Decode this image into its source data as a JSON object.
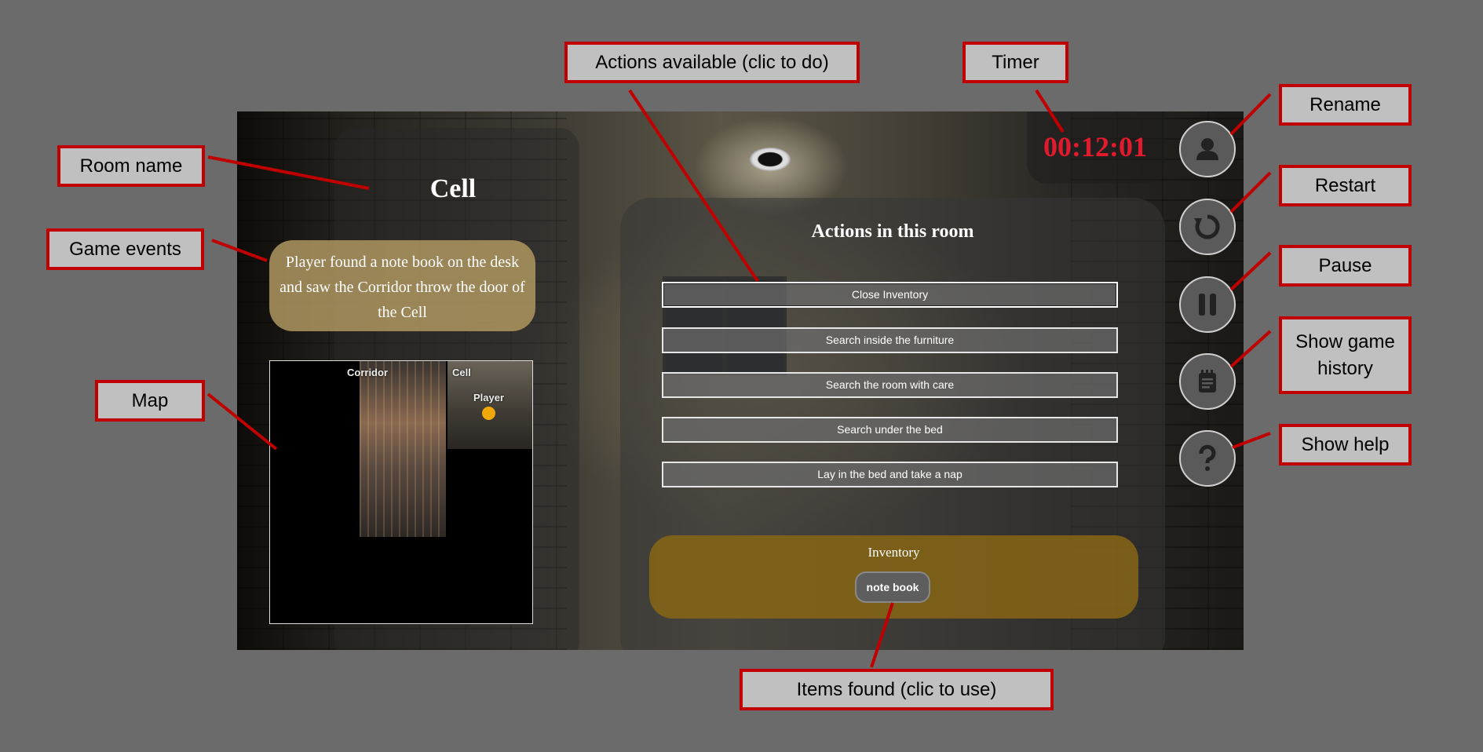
{
  "game": {
    "room_name": "Cell",
    "event_text": "Player found a note book on the desk and saw the Corridor throw the door of the Cell",
    "map": {
      "corridor_label": "Corridor",
      "cell_label": "Cell",
      "player_label": "Player"
    },
    "timer": "00:12:01",
    "actions_title": "Actions in this room",
    "actions": [
      "Close Inventory",
      "Search inside the furniture",
      "Search the room with care",
      "Search under the bed",
      "Lay in the bed and take a nap"
    ],
    "inventory_title": "Inventory",
    "inventory_items": [
      "note book"
    ],
    "side_buttons": [
      "user-icon",
      "restart-icon",
      "pause-icon",
      "notepad-icon",
      "question-icon"
    ],
    "colors": {
      "timer": "#e21a2e",
      "player_dot": "#f2a80b",
      "inventory_bg": "#8a6814",
      "event_bg": "#ae9660",
      "annotation_border": "#c00000"
    }
  },
  "annotations": {
    "room_name": "Room name",
    "game_events": "Game events",
    "map": "Map",
    "actions": "Actions available (clic to do)",
    "timer": "Timer",
    "rename": "Rename",
    "restart": "Restart",
    "pause": "Pause",
    "history": "Show game history",
    "help": "Show help",
    "items": "Items found (clic to use)"
  }
}
